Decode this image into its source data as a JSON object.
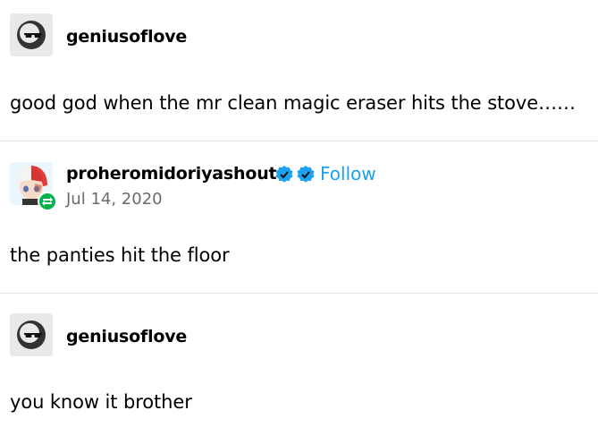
{
  "posts": [
    {
      "username": "geniusoflove",
      "content": "good god when the mr clean magic eraser hits the stove……"
    },
    {
      "username": "proheromidoriyashouto",
      "follow_label": "Follow",
      "date": "Jul 14, 2020",
      "content": "the panties hit the floor"
    },
    {
      "username": "geniusoflove",
      "content": "you know it brother"
    }
  ],
  "colors": {
    "accent": "#1da1f2",
    "reblog": "#00b34a",
    "divider": "#e3e3e3"
  }
}
